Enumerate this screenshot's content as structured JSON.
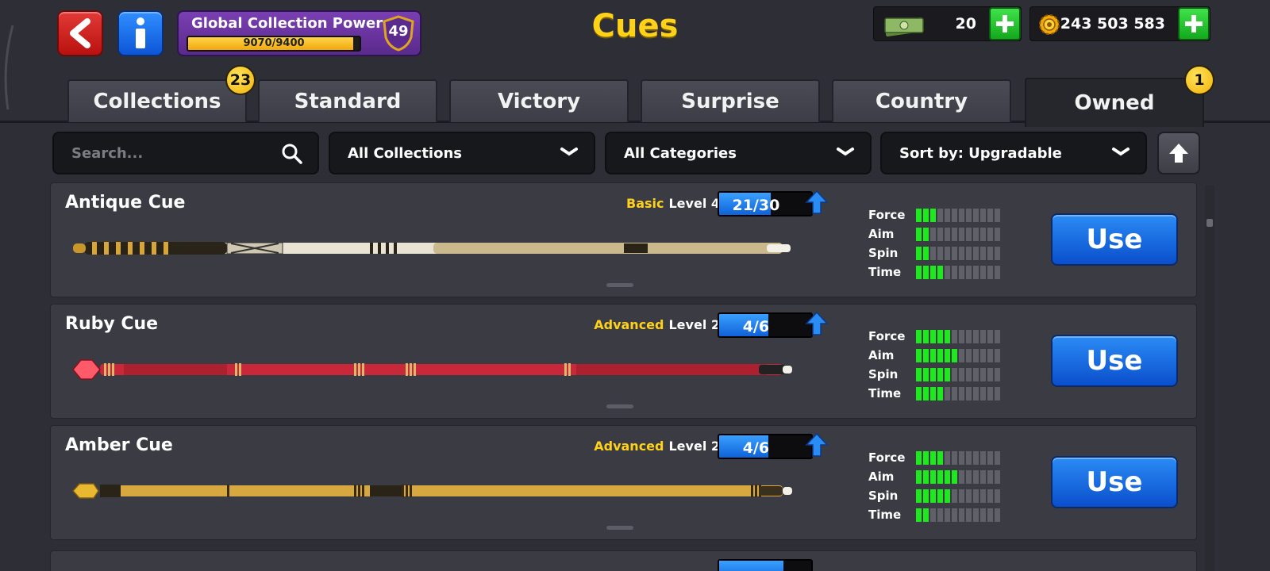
{
  "header": {
    "title": "Cues",
    "global_collection_power": {
      "label": "Global Collection Power",
      "progress_text": "9070/9400",
      "current": 9070,
      "max": 9400,
      "level": "49"
    },
    "cash": {
      "value": "20",
      "icon": "cash-stack-icon"
    },
    "coins": {
      "value": "243 503 583",
      "icon": "gear-coin-icon"
    },
    "colors": {
      "title": "#ffd21a",
      "back": "#d4201d",
      "info": "#1a6fe8",
      "plus": "#22c22c"
    }
  },
  "tabs": [
    {
      "label": "Collections",
      "badge": "23",
      "active": false
    },
    {
      "label": "Standard",
      "active": false
    },
    {
      "label": "Victory",
      "active": false
    },
    {
      "label": "Surprise",
      "active": false
    },
    {
      "label": "Country",
      "active": false
    },
    {
      "label": "Owned",
      "badge": "1",
      "active": true
    }
  ],
  "filters": {
    "search_placeholder": "Search...",
    "collections": "All Collections",
    "categories": "All Categories",
    "sort": "Sort by: Upgradable"
  },
  "stat_labels": {
    "force": "Force",
    "aim": "Aim",
    "spin": "Spin",
    "time": "Time"
  },
  "cues": [
    {
      "name": "Antique Cue",
      "rarity": "Basic",
      "level": "Level 4",
      "progress": "21/30",
      "progress_fraction": 0.7,
      "stats": {
        "force": 3,
        "aim": 2,
        "spin": 2,
        "time": 4
      },
      "use_label": "Use"
    },
    {
      "name": "Ruby Cue",
      "rarity": "Advanced",
      "level": "Level 2",
      "progress": "4/6",
      "progress_fraction": 0.667,
      "stats": {
        "force": 5,
        "aim": 6,
        "spin": 5,
        "time": 4
      },
      "use_label": "Use"
    },
    {
      "name": "Amber Cue",
      "rarity": "Advanced",
      "level": "Level 2",
      "progress": "4/6",
      "progress_fraction": 0.667,
      "stats": {
        "force": 4,
        "aim": 6,
        "spin": 5,
        "time": 2
      },
      "use_label": "Use"
    }
  ]
}
